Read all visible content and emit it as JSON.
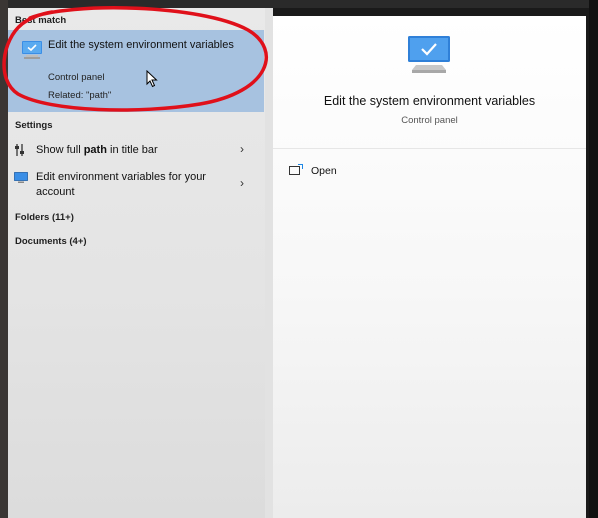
{
  "left": {
    "best_match_heading": "Best match",
    "best_match": {
      "title": "Edit the system environment variables",
      "subtitle": "Control panel",
      "related": "Related: \"path\""
    },
    "settings_heading": "Settings",
    "settings": [
      {
        "pre": "Show full ",
        "bold": "path",
        "post": " in title bar"
      },
      {
        "text": "Edit environment variables for your account"
      }
    ],
    "folders_heading": "Folders (11+)",
    "documents_heading": "Documents (4+)"
  },
  "right": {
    "title": "Edit the system environment variables",
    "subtitle": "Control panel",
    "open_label": "Open"
  },
  "colors": {
    "highlight": "#a7c2e0",
    "annotation": "#e0101a",
    "accent": "#1e88e5"
  },
  "icons": {
    "best_match": "monitor-check-icon",
    "setting_1": "sliders-icon",
    "setting_2": "monitor-icon",
    "chevron": "chevron-right-icon",
    "open": "open-window-icon"
  }
}
